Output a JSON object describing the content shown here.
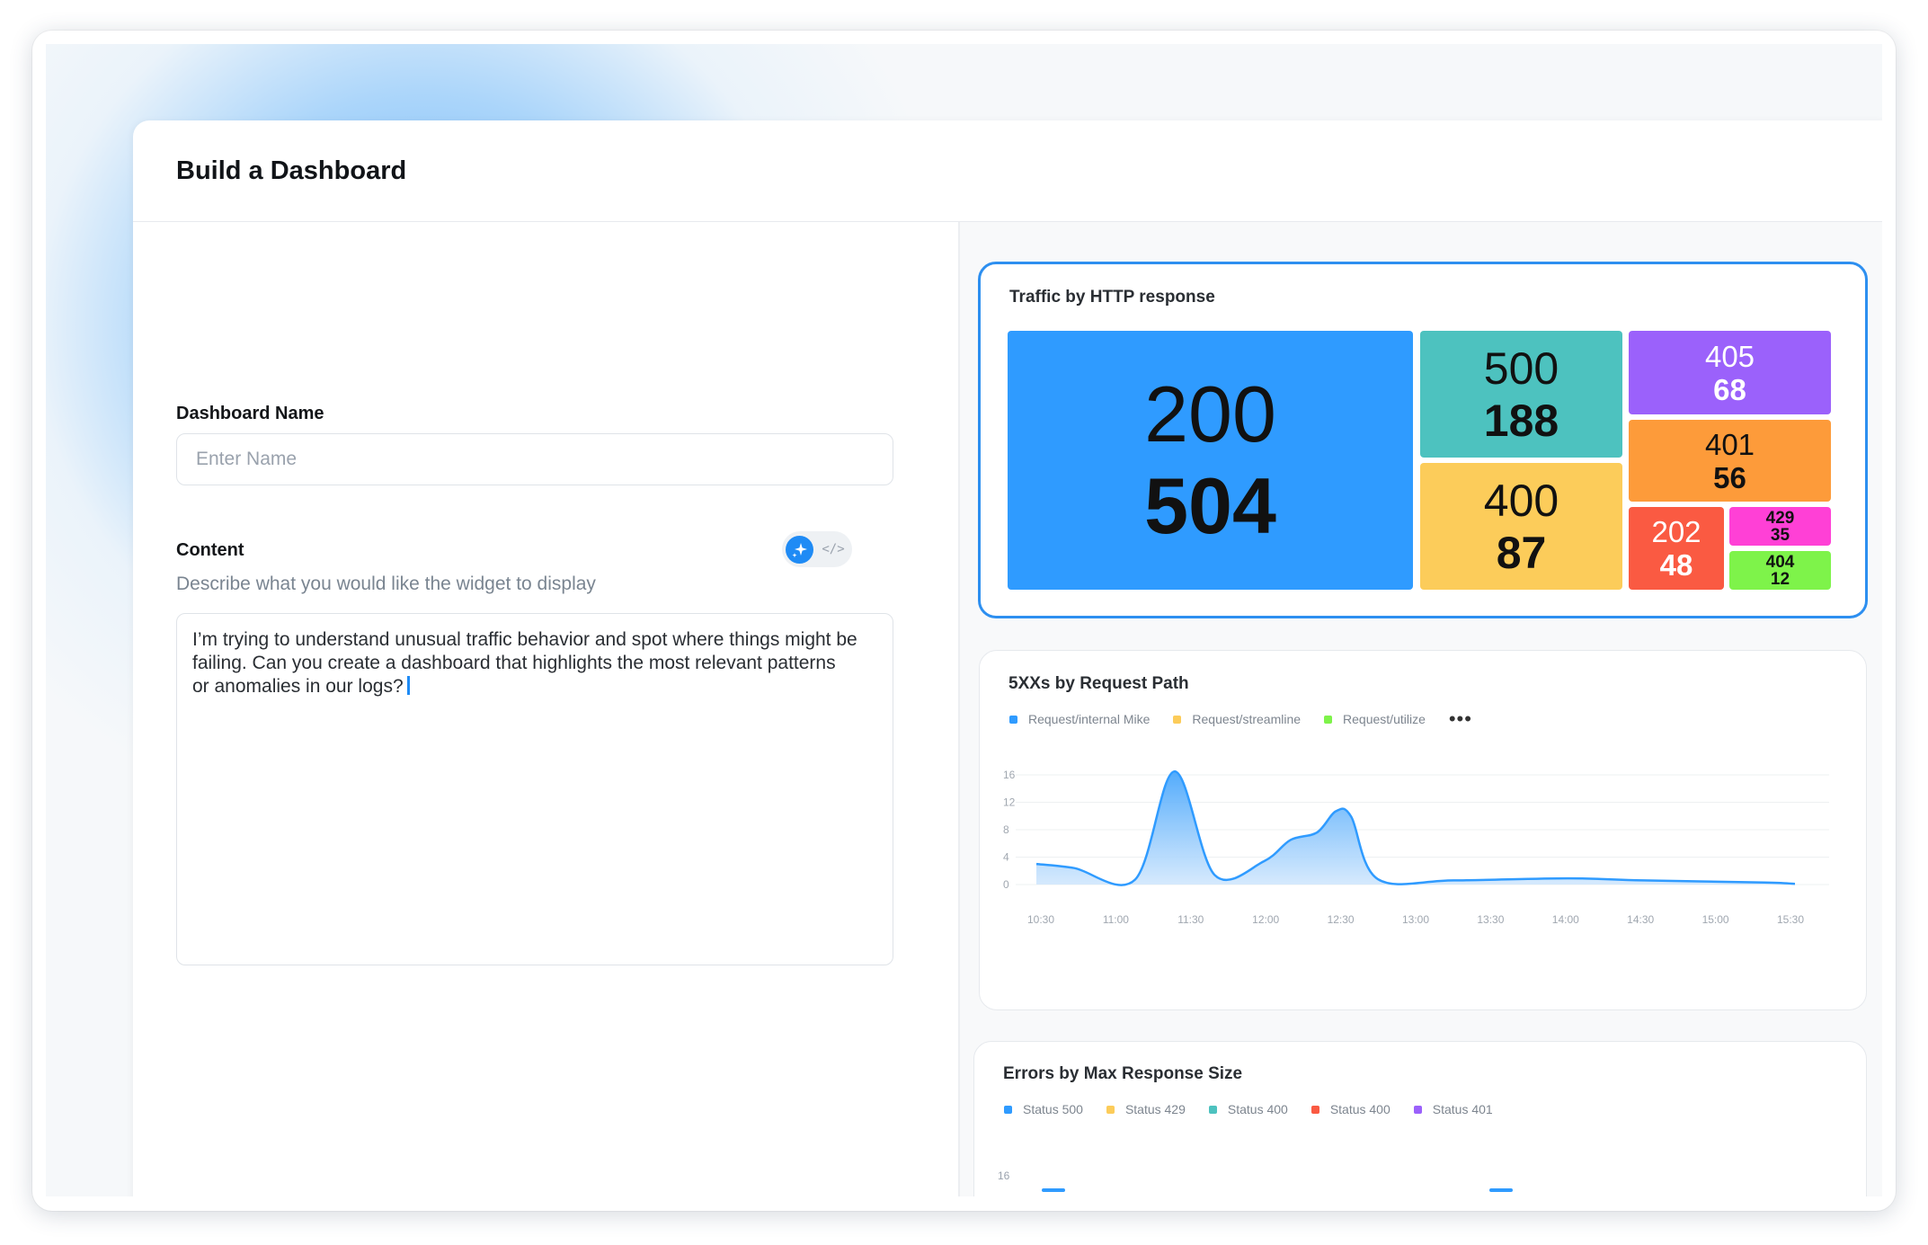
{
  "window": {
    "title": "Build a Dashboard"
  },
  "form": {
    "name_label": "Dashboard Name",
    "name_placeholder": "Enter Name",
    "content_label": "Content",
    "content_hint": "Describe what you would like the widget to display",
    "content_text": "I’m trying to understand unusual traffic behavior and spot where things might be failing. Can you create a dashboard that highlights the most relevant patterns or anomalies in our logs?",
    "toggle": {
      "ai_icon": "sparkle-icon",
      "code_icon": "code-icon",
      "code_glyph": "</>"
    }
  },
  "widgets": {
    "traffic": {
      "title": "Traffic by HTTP response",
      "cells": [
        {
          "code": "200",
          "count": "504",
          "color": "#2f9bff"
        },
        {
          "code": "500",
          "count": "188",
          "color": "#4dc2bf"
        },
        {
          "code": "400",
          "count": "87",
          "color": "#fccc5a"
        },
        {
          "code": "405",
          "count": "68",
          "color": "#9b61fb"
        },
        {
          "code": "401",
          "count": "56",
          "color": "#fd9b3a"
        },
        {
          "code": "202",
          "count": "48",
          "color": "#fa5a42"
        },
        {
          "code": "429",
          "count": "35",
          "color": "#ff40d6"
        },
        {
          "code": "404",
          "count": "12",
          "color": "#7ef34a"
        }
      ]
    },
    "errors_path": {
      "title": "5XXs by Request Path",
      "legend": [
        {
          "label": "Request/internal Mike",
          "color": "#2f9bff"
        },
        {
          "label": "Request/streamline",
          "color": "#fccc5a"
        },
        {
          "label": "Request/utilize",
          "color": "#7ef34a"
        }
      ],
      "more": "•••"
    },
    "errors_size": {
      "title": "Errors by Max Response Size",
      "legend": [
        {
          "label": "Status 500",
          "color": "#2f9bff"
        },
        {
          "label": "Status 429",
          "color": "#fccc5a"
        },
        {
          "label": "Status 400",
          "color": "#4dc2bf"
        },
        {
          "label": "Status 400",
          "color": "#fa5a42"
        },
        {
          "label": "Status 401",
          "color": "#9b61fb"
        }
      ],
      "y_tick_top": "16"
    }
  },
  "chart_data": [
    {
      "type": "area",
      "title": "5XXs by Request Path",
      "x": [
        "10:30",
        "11:00",
        "11:30",
        "12:00",
        "12:30",
        "13:00",
        "13:30",
        "14:00",
        "14:30",
        "15:00",
        "15:30"
      ],
      "y_ticks": [
        0,
        4,
        8,
        12,
        16
      ],
      "ylim": [
        0,
        16
      ],
      "series": [
        {
          "name": "Request/internal Mike",
          "color": "#2f9bff",
          "points": [
            [
              0,
              3.0
            ],
            [
              0.5,
              2.4
            ],
            [
              1.3,
              0.7
            ],
            [
              1.82,
              16.5
            ],
            [
              2.35,
              1.4
            ],
            [
              3.0,
              3.4
            ],
            [
              3.35,
              6.5
            ],
            [
              3.7,
              7.6
            ],
            [
              3.95,
              10.7
            ],
            [
              4.15,
              9.9
            ],
            [
              4.5,
              0.8
            ],
            [
              5.5,
              0.6
            ],
            [
              7,
              0.9
            ],
            [
              8,
              0.6
            ],
            [
              9.6,
              0.3
            ],
            [
              10,
              0.1
            ]
          ]
        }
      ],
      "grid": true
    }
  ]
}
